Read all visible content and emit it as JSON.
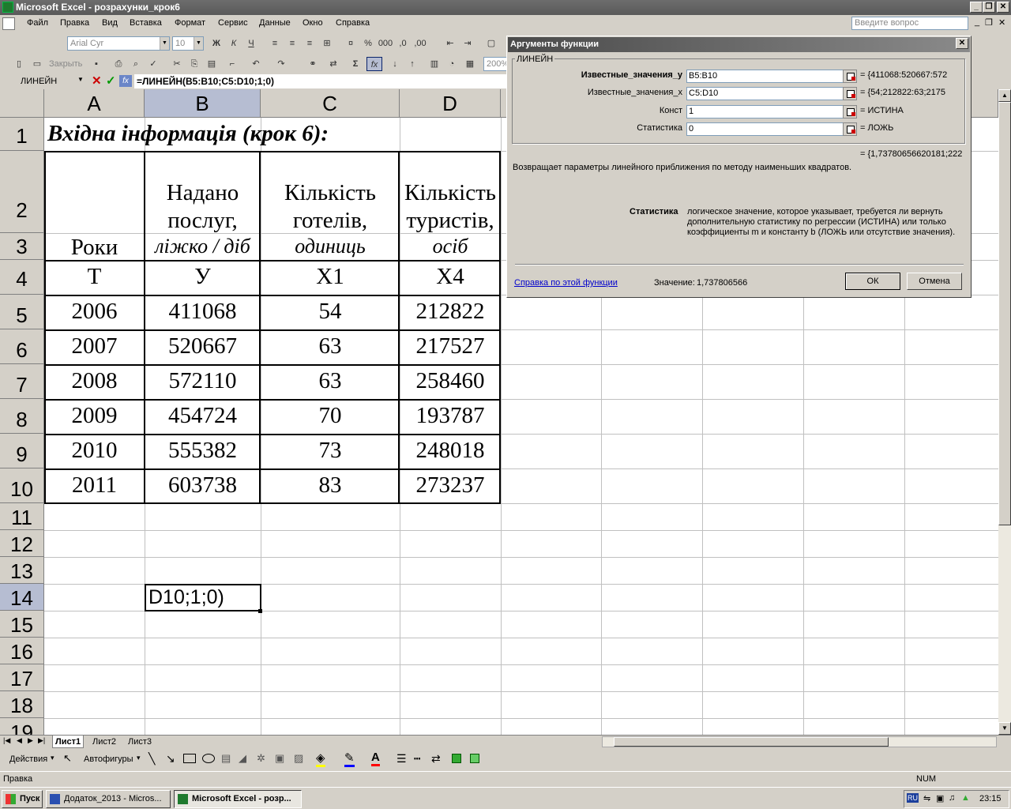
{
  "window": {
    "title": "Microsoft Excel - розрахунки_крок6"
  },
  "menu": {
    "items": [
      "Файл",
      "Правка",
      "Вид",
      "Вставка",
      "Формат",
      "Сервис",
      "Данные",
      "Окно",
      "Справка"
    ],
    "ask_placeholder": "Введите вопрос"
  },
  "toolbar": {
    "font": "Arial Cyr",
    "size": "10",
    "close_label": "Закрыть",
    "zoom": "200%"
  },
  "formula_bar": {
    "name_box": "ЛИНЕЙН",
    "formula": "=ЛИНЕЙН(B5:B10;C5:D10;1;0)"
  },
  "sheet": {
    "columns": [
      "A",
      "B",
      "C",
      "D"
    ],
    "rows": [
      "1",
      "2",
      "3",
      "4",
      "5",
      "6",
      "7",
      "8",
      "9",
      "10",
      "11",
      "12",
      "13",
      "14",
      "15",
      "16",
      "17",
      "18",
      "19"
    ],
    "title": "Вхідна інформація (крок 6):",
    "header": {
      "a": "Роки",
      "b1": "Надано",
      "b2": "послуг,",
      "b3": "ліжко / діб",
      "c1": "Кількість",
      "c2": "готелів,",
      "c3": "одиниць",
      "d1": "Кількість",
      "d2": "туристів,",
      "d3": "осіб"
    },
    "symbols": [
      "T",
      "У",
      "X1",
      "X4"
    ],
    "data": [
      [
        "2006",
        "411068",
        "54",
        "212822"
      ],
      [
        "2007",
        "520667",
        "63",
        "217527"
      ],
      [
        "2008",
        "572110",
        "63",
        "258460"
      ],
      [
        "2009",
        "454724",
        "70",
        "193787"
      ],
      [
        "2010",
        "555382",
        "73",
        "248018"
      ],
      [
        "2011",
        "603738",
        "83",
        "273237"
      ]
    ],
    "edit_cell": "D10;1;0)"
  },
  "sheet_tabs": [
    "Лист1",
    "Лист2",
    "Лист3"
  ],
  "drawing": {
    "actions": "Действия",
    "autoshapes": "Автофигуры"
  },
  "status": {
    "left": "Правка",
    "num": "NUM"
  },
  "taskbar": {
    "start": "Пуск",
    "tasks": [
      "Додаток_2013 - Micros...",
      "Microsoft Excel - розр..."
    ],
    "lang": "RU",
    "time": "23:15"
  },
  "dialog": {
    "title": "Аргументы функции",
    "group": "ЛИНЕЙН",
    "args": [
      {
        "label": "Известные_значения_y",
        "value": "B5:B10",
        "result": "= {411068:520667:572"
      },
      {
        "label": "Известные_значения_x",
        "value": "C5:D10",
        "result": "= {54;212822:63;2175"
      },
      {
        "label": "Конст",
        "value": "1",
        "result": "= ИСТИНА"
      },
      {
        "label": "Статистика",
        "value": "0",
        "result": "= ЛОЖЬ"
      }
    ],
    "total": "= {1,73780656620181;222",
    "description": "Возвращает параметры линейного приближения по методу наименьших квадратов.",
    "param_name": "Статистика",
    "param_desc1": "логическое значение, которое указывает, требуется ли вернуть",
    "param_desc2": "дополнительную статистику по регрессии (ИСТИНА) или только",
    "param_desc3": "коэффициенты m и константу b (ЛОЖЬ или отсутствие значения).",
    "help_link": "Справка по этой функции",
    "value_label": "Значение:",
    "value": "1,737806566",
    "ok": "ОК",
    "cancel": "Отмена"
  }
}
